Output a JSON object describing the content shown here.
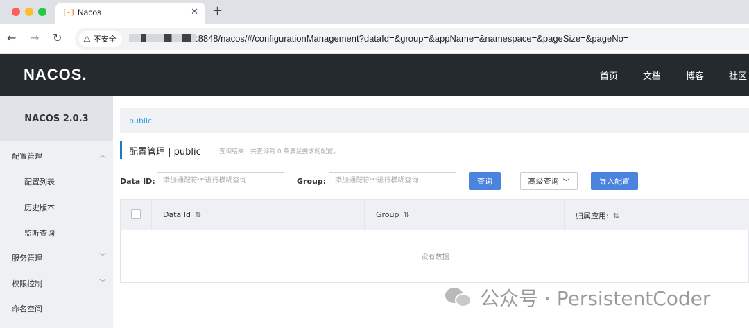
{
  "browser": {
    "tab_title": "Nacos",
    "tab_close": "✕",
    "newtab": "+",
    "security_label": "不安全",
    "url_visible": ":8848/nacos/#/configurationManagement?dataId=&group=&appName=&namespace=&pageSize=&pageNo="
  },
  "header": {
    "logo": "NACOS.",
    "nav": [
      "首页",
      "文档",
      "博客",
      "社区"
    ]
  },
  "sidebar": {
    "title": "NACOS 2.0.3",
    "items": [
      {
        "label": "配置管理",
        "chevron": "︿"
      },
      {
        "label": "配置列表"
      },
      {
        "label": "历史版本"
      },
      {
        "label": "监听查询"
      },
      {
        "label": "服务管理",
        "chevron": "﹀"
      },
      {
        "label": "权限控制",
        "chevron": "﹀"
      },
      {
        "label": "命名空间"
      }
    ]
  },
  "main": {
    "breadcrumb": "public",
    "title": "配置管理  |  public",
    "summary": "查询结果：共查询到 0 条满足要求的配置。",
    "filters": {
      "dataid_label": "Data ID:",
      "dataid_placeholder": "添加通配符'*'进行模糊查询",
      "group_label": "Group:",
      "group_placeholder": "添加通配符'*'进行模糊查询",
      "query_button": "查询",
      "advanced_button": "高级查询",
      "import_button": "导入配置"
    },
    "table": {
      "columns": [
        "Data Id",
        "Group",
        "归属应用:"
      ],
      "empty_text": "没有数据"
    }
  },
  "watermark": "公众号 · PersistentCoder"
}
